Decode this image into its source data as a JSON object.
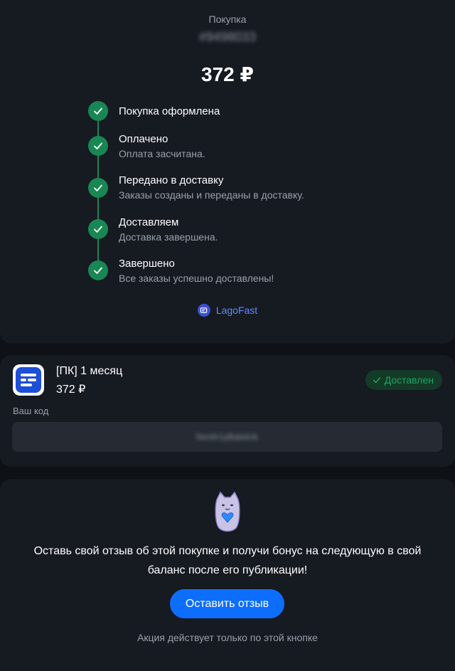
{
  "purchase": {
    "label": "Покупка",
    "order_number": "#9498033",
    "total": "372 ₽"
  },
  "timeline": [
    {
      "title": "Покупка оформлена",
      "description": ""
    },
    {
      "title": "Оплачено",
      "description": "Оплата засчитана."
    },
    {
      "title": "Передано в доставку",
      "description": "Заказы созданы и переданы в доставку."
    },
    {
      "title": "Доставляем",
      "description": "Доставка завершена."
    },
    {
      "title": "Завершено",
      "description": "Все заказы успешно доставлены!"
    }
  ],
  "brand": {
    "name": "LagoFast",
    "icon": "lagofast-logo-icon"
  },
  "product": {
    "name": "[ПК] 1 месяц",
    "price": "372 ₽",
    "status": "Доставлен",
    "code_label": "Ваш код",
    "code_value": "Nenth1yBabdcik"
  },
  "review": {
    "text": "Оставь свой отзыв об этой покупке и получи бонус на следующую в свой баланс после его публикации!",
    "button_label": "Оставить отзыв",
    "note": "Акция действует только по этой кнопке"
  },
  "colors": {
    "accent_green": "#198754",
    "button_blue": "#0d6efd",
    "brand_blue": "#5b8cff"
  }
}
